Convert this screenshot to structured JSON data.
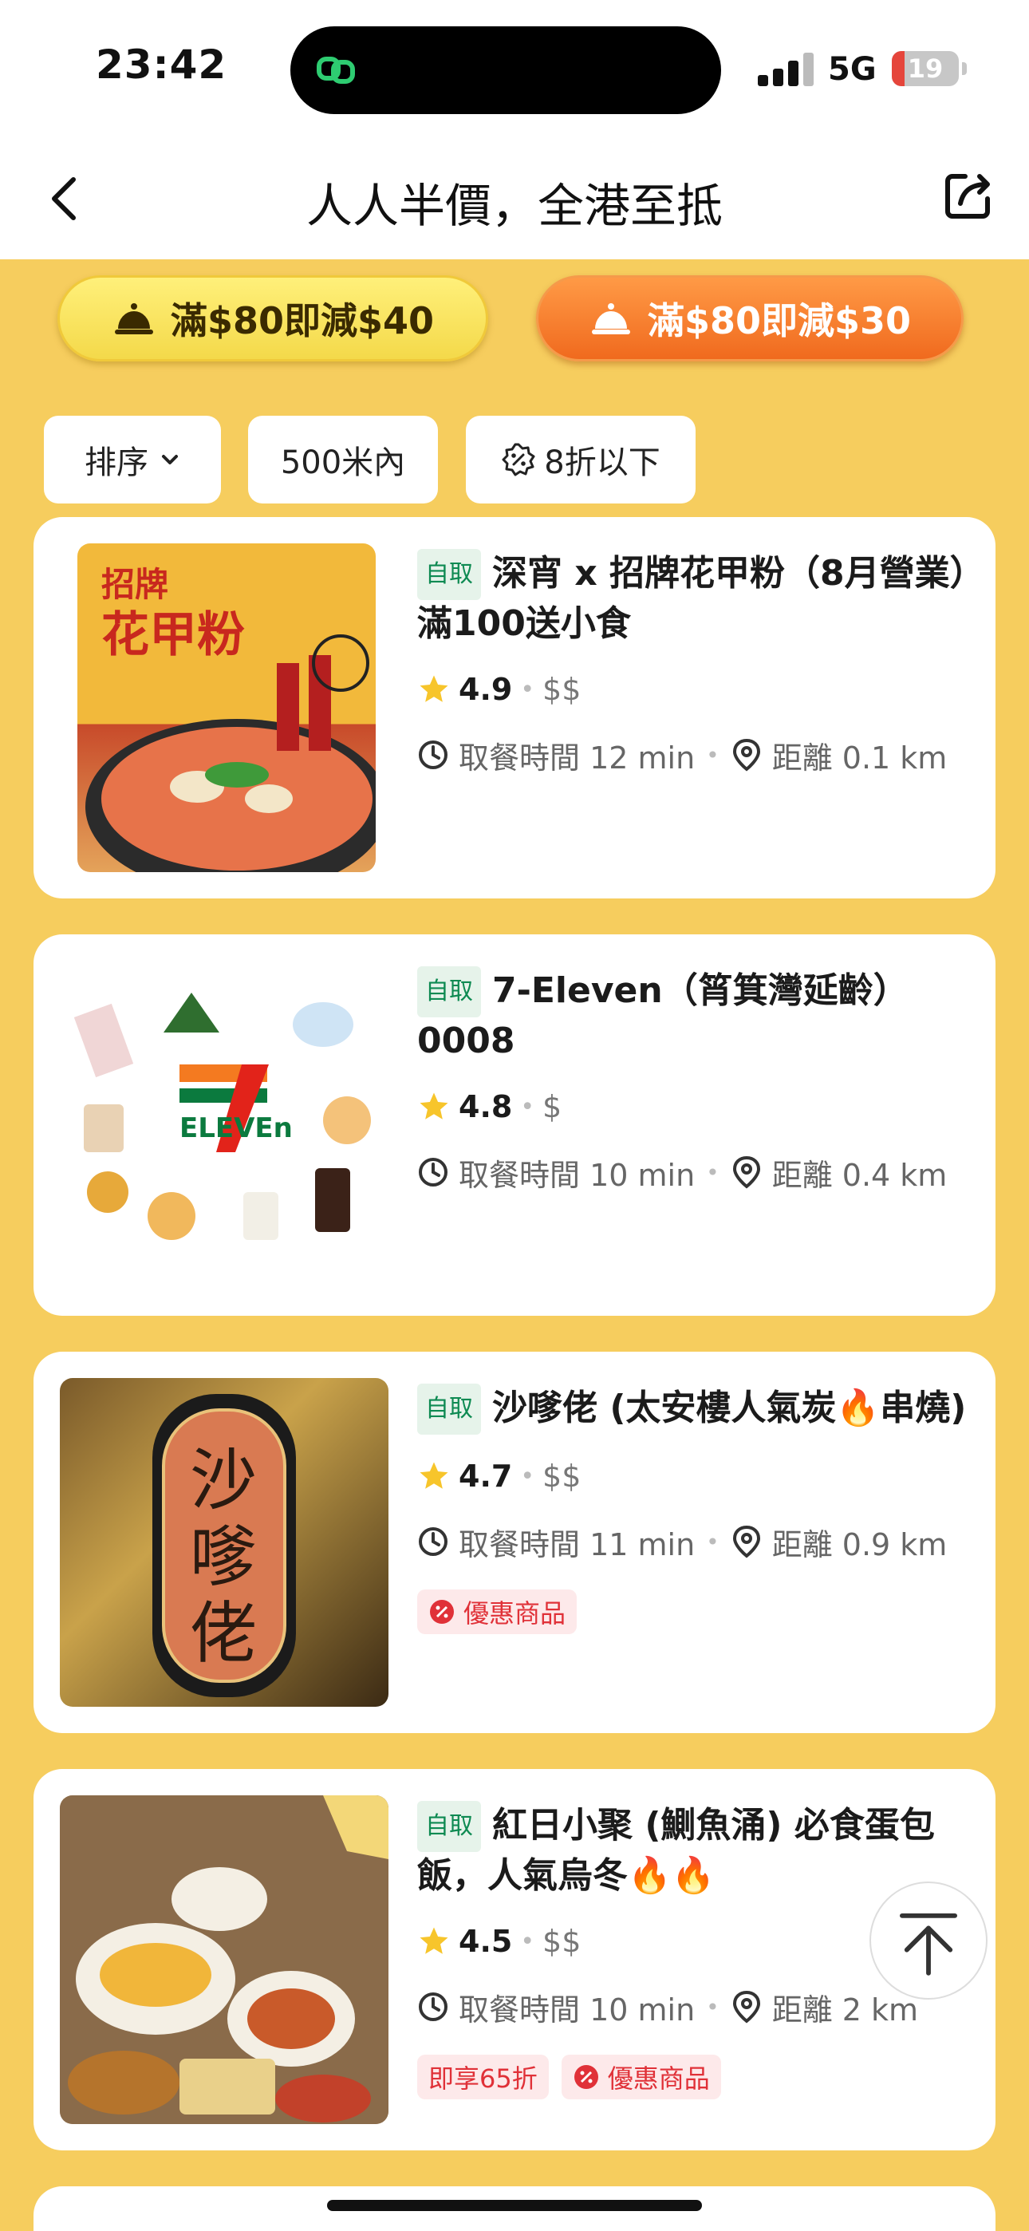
{
  "status_bar": {
    "time": "23:42",
    "network": "5G",
    "battery": "19"
  },
  "nav": {
    "title": "人人半價，全港至抵"
  },
  "promos": [
    {
      "label": "滿$80即減$40"
    },
    {
      "label": "滿$80即減$30"
    }
  ],
  "filters": {
    "sort": "排序",
    "distance": "500米內",
    "discount": "8折以下"
  },
  "stores": [
    {
      "tag": "自取",
      "name": "深宵 x 招牌花甲粉（8月營業）滿100送小食",
      "rating": "4.9",
      "price": "$$",
      "pickup": "取餐時間 12 min",
      "distance": "距離 0.1 km",
      "badges": [],
      "thumb_words": [
        "招牌",
        "花甲粉"
      ]
    },
    {
      "tag": "自取",
      "name": "7-Eleven（筲箕灣延齡）0008",
      "rating": "4.8",
      "price": "$",
      "pickup": "取餐時間 10 min",
      "distance": "距離 0.4 km",
      "badges": [],
      "thumb_words": [
        "ELEVEn"
      ]
    },
    {
      "tag": "自取",
      "name": "沙嗲佬 (太安樓人氣炭🔥串燒)",
      "rating": "4.7",
      "price": "$$",
      "pickup": "取餐時間 11 min",
      "distance": "距離 0.9 km",
      "badges": [
        "優惠商品"
      ],
      "thumb_words": [
        "沙",
        "嗲",
        "佬"
      ]
    },
    {
      "tag": "自取",
      "name": "紅日小聚 (鰂魚涌) 必食蛋包飯，人氣烏冬🔥🔥",
      "rating": "4.5",
      "price": "$$",
      "pickup": "取餐時間 10 min",
      "distance": "距離 2 km",
      "badges": [
        "即享65折",
        "優惠商品"
      ],
      "thumb_words": []
    }
  ],
  "colors": {
    "background": "#f6cd5e",
    "self_tag": "#0e8a52",
    "badge_red": "#e03138",
    "promo_orange": "#f06a1e"
  }
}
